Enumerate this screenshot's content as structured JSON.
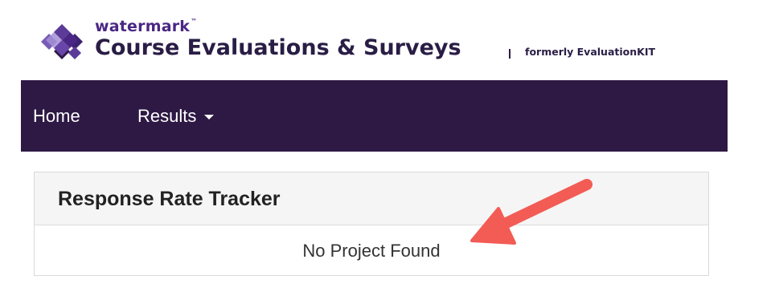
{
  "brand": {
    "name": "watermark",
    "trademark": "™",
    "product": "Course Evaluations & Surveys",
    "former_note": "formerly EvaluationKIT",
    "colors": {
      "purple": "#4a2784",
      "dark": "#2a1d45"
    }
  },
  "nav": {
    "background": "#2e1945",
    "items": [
      {
        "label": "Home"
      },
      {
        "label": "Results",
        "has_dropdown": true
      }
    ]
  },
  "panel": {
    "title": "Response Rate Tracker",
    "message": "No Project Found"
  },
  "annotation": {
    "type": "arrow",
    "color": "#f25c54",
    "points_to": "No Project Found"
  }
}
